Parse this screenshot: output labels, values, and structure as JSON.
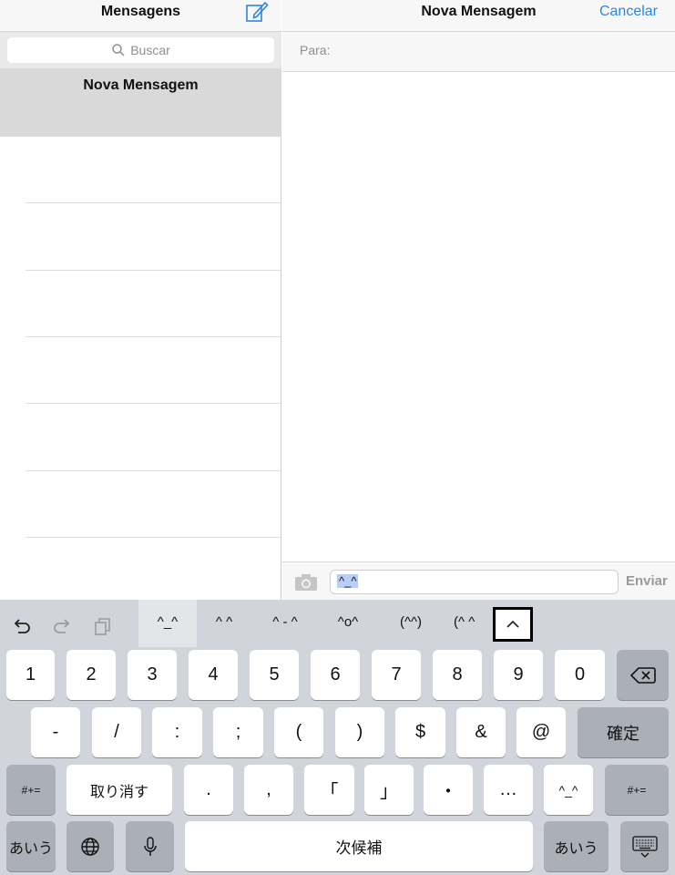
{
  "left_pane": {
    "title": "Mensagens",
    "search_placeholder": "Buscar",
    "selected_item": "Nova Mensagem"
  },
  "right_pane": {
    "title": "Nova Mensagem",
    "cancel_label": "Cancelar",
    "to_label": "Para:",
    "message_text": "^_^",
    "send_label": "Enviar"
  },
  "keyboard": {
    "candidates": [
      "^_^",
      "^ ^",
      "^ - ^",
      "^o^",
      "(^^)",
      "(^ ^"
    ],
    "row1": [
      "1",
      "2",
      "3",
      "4",
      "5",
      "6",
      "7",
      "8",
      "9",
      "0"
    ],
    "row2": [
      "-",
      "/",
      ":",
      ";",
      "(",
      ")",
      "$",
      "&",
      "@"
    ],
    "confirm_label": "確定",
    "row3_left": "#+=",
    "undo_label": "取り消す",
    "row3": [
      ".",
      ",",
      "「",
      "」",
      "・",
      "…",
      "^_^"
    ],
    "row3_right": "#+=",
    "kana_label": "あいう",
    "space_label": "次候補",
    "kana_label_right": "あいう"
  },
  "colors": {
    "accent": "#2e86de",
    "keyboard_bg": "#d1d4da",
    "dark_key": "#abafb8"
  },
  "icons": [
    "compose-icon",
    "search-icon",
    "camera-icon",
    "undo-icon",
    "redo-icon",
    "paste-icon",
    "chevron-up-icon",
    "backspace-icon",
    "globe-icon",
    "microphone-icon",
    "hide-keyboard-icon"
  ]
}
